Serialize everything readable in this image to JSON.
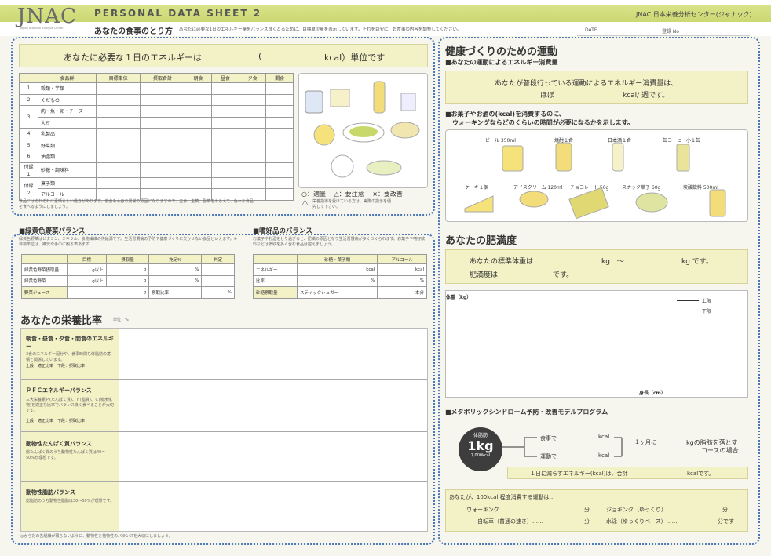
{
  "header": {
    "brand": "JNAC",
    "brand_sub": "Japan Nutrition Analysis Center",
    "sheet_title": "PERSONAL DATA SHEET 2",
    "center_name": "JNAC 日本栄養分析センター(ジャナック)",
    "subtitle": "あなたの食事のとり方",
    "subtitle_desc": "あなたに必要な1日のエネルギー量をバランス良くとるために、目標単位量を表示しています。それを目安に、お食事の内容を調整してください。",
    "date_label": "DATE",
    "reg_label": "登録 No"
  },
  "energy_banner": {
    "prefix": "あなたに必要な１日のエネルギーは",
    "open": "(",
    "suffix": "kcal）単位です"
  },
  "food_table": {
    "headers": [
      "",
      "食品群",
      "目標単位",
      "摂取合計",
      "朝食",
      "昼食",
      "夕食",
      "間食"
    ],
    "rows": [
      {
        "no": "1",
        "name": "穀類・芋類"
      },
      {
        "no": "2",
        "name": "くだもの"
      },
      {
        "no": "3",
        "name": "肉・魚・卵・チーズ"
      },
      {
        "no": "",
        "name": "大豆"
      },
      {
        "no": "4",
        "name": "乳製品"
      },
      {
        "no": "5",
        "name": "野菜類"
      },
      {
        "no": "6",
        "name": "油脂類"
      },
      {
        "no": "付録１",
        "name": "砂糖・調味料"
      },
      {
        "no": "付録２",
        "name": "菓子類"
      },
      {
        "no": "",
        "name": "アルコール"
      }
    ],
    "note": "食品にはそれぞれに素晴らしい働きがあります。偏食も心身の異常の原因になりますので、主食、主菜、副菜をそろえて、色々な食品を食べるようにしましょう。"
  },
  "food_legend": {
    "ok": "○：適量",
    "caution": "△：要注意",
    "improve": "×：要改善",
    "warning": "栄養指導を受けている方は、実際の指示を優先して下さい。"
  },
  "green_veg": {
    "title": "■緑黄色野菜バランス",
    "desc": "緑黄色野菜はビタミン、ミネラル、食物繊維の供給源です。生活習慣病の予防や健康づくりに欠かせない食品といえます。※目標単位は、推奨や手のに観る表あます",
    "headers": [
      "",
      "目標",
      "摂取量",
      "充足%",
      "判定"
    ],
    "rows": [
      {
        "name": "緑黄色野菜摂取量",
        "target_unit": "g以上",
        "intake_unit": "g",
        "pct_unit": "%"
      },
      {
        "name": "緑黄色野菜",
        "target_unit": "g以上",
        "intake_unit": "g",
        "pct_unit": "%"
      }
    ],
    "juice": {
      "name": "野菜ジュース",
      "unit": "g",
      "ratio_label": "摂取比率",
      "ratio_unit": "%"
    }
  },
  "luxury": {
    "title": "■嗜好品のバランス",
    "desc": "お菓子やお酒をとり過ぎると、肥満の原因となり生活習慣病が多くつくられます。お菓子や嗜好飲料などは摂取を多く含む食品は控えましょう。",
    "headers": [
      "",
      "砂糖・菓子類",
      "アルコール"
    ],
    "rows": [
      {
        "name": "エネルギー",
        "a": "kcal",
        "b": "kcal"
      },
      {
        "name": "比率",
        "a": "%",
        "b": "%"
      },
      {
        "name": "砂糖摂取量",
        "a": "スティックシュガー",
        "b": "本分"
      }
    ]
  },
  "nutrition": {
    "title": "あなたの栄養比率",
    "unit": "単位：%",
    "rows": [
      {
        "title": "朝食・昼食・夕食・間食のエネルギー",
        "desc": "3食のエネルギー配分や、食事時間も体脂肪の蓄積と関係しています。",
        "ratio": "上段：適正比率　下段：摂取比率"
      },
      {
        "title": "ＰＦＣエネルギーバランス",
        "desc": "三大栄養素Ｐ(たんぱく質)、Ｆ(脂質)、Ｃ(炭水化物)を適正な比率でバランス良く食べることが大切です。",
        "ratio": "上段：適正比率　下段：摂取比率"
      },
      {
        "title": "動物性たんぱく質バランス",
        "desc": "総たんぱく質のうち動物性たんぱく質は40～50%が理想です。",
        "ratio": ""
      },
      {
        "title": "動物性脂肪バランス",
        "desc": "総脂肪のうち動物性脂肪は30～50%が理想です。",
        "ratio": ""
      }
    ],
    "footnote": "◎からだの各組織が弱らないように、動物性と植物性のバランスを大切にしましょう。"
  },
  "exercise": {
    "title": "健康づくりのための運動",
    "sec1": "■あなたの運動によるエネルギー消費量",
    "line1": "あなたが普段行っている運動によるエネルギー消費量は、",
    "line2a": "ほぼ",
    "line2b": "kcal/ 週です。",
    "sec2a": "■お菓子やお酒の(kcal)を消費するのに、",
    "sec2b": "ウォーキングならどのくらいの時間が必要になるかを示します。",
    "items_row1": [
      "ビール 350ml",
      "焼酎１合",
      "日本酒１合",
      "缶コーヒー小１缶"
    ],
    "items_row2": [
      "ケーキ１個",
      "アイスクリーム 120ml",
      "チョコレート 50g",
      "スナック菓子 60g",
      "炭酸飲料 500ml"
    ]
  },
  "obesity": {
    "title": "あなたの肥満度",
    "line1a": "あなたの標準体重は",
    "line1b": "kg　～",
    "line1c": "kg です。",
    "line2a": "肥満度は",
    "line2b": "です。",
    "y_label": "体重（kg）",
    "x_label": "身長（cm）",
    "legend_upper": "上限",
    "legend_lower": "下限"
  },
  "metabolic": {
    "title": "■メタボリックシンドローム予防・改善モデルプログラム",
    "circle_top": "体脂肪",
    "circle_main": "1kg",
    "circle_sub": "7,000kcal",
    "meal": "食事で",
    "exercise": "運動で",
    "kcal": "kcal",
    "month": "１ヶ月に",
    "result1": "kgの脂肪を落とす",
    "result2": "コースの場合",
    "daily": "１日に減らすエネルギー(kcal)は、合計",
    "daily_unit": "kcalです。",
    "activity_title": "あなたが、100kcal 程度消費する運動は…",
    "walking": "ウォーキング…………",
    "jogging": "ジョギング（ゆっくり）……",
    "cycling": "自転車（普通の速さ）……",
    "swimming": "水泳（ゆっくりペース）……",
    "min": "分",
    "min_end": "分です"
  }
}
